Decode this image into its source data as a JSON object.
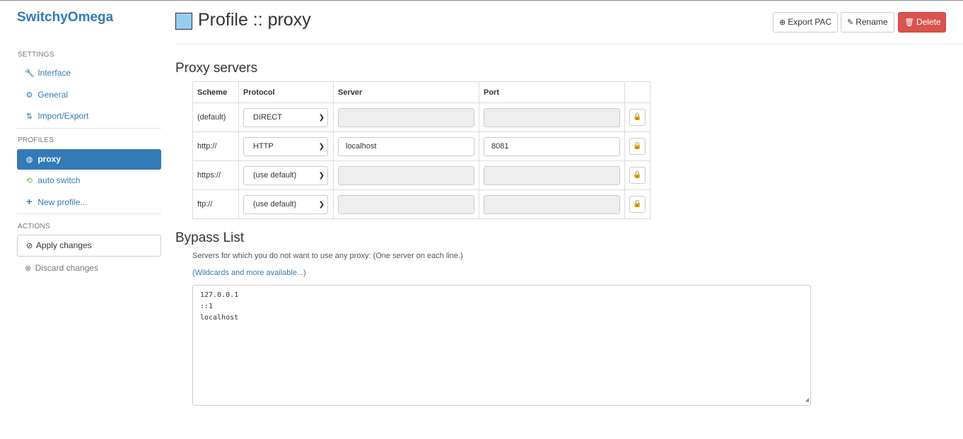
{
  "app": {
    "brand": "SwitchyOmega"
  },
  "sidebar": {
    "settings_title": "SETTINGS",
    "settings": [
      {
        "icon": "wrench-icon",
        "glyph": "🔧",
        "label": "Interface"
      },
      {
        "icon": "gear-icon",
        "glyph": "⚙",
        "label": "General"
      },
      {
        "icon": "import-export-icon",
        "glyph": "⇅",
        "label": "Import/Export"
      }
    ],
    "profiles_title": "PROFILES",
    "profiles": [
      {
        "icon": "globe-icon",
        "glyph": "◍",
        "label": "proxy",
        "active": true
      },
      {
        "icon": "retweet-icon",
        "glyph": "⟲",
        "label": "auto switch"
      },
      {
        "icon": "plus-icon",
        "glyph": "+",
        "label": "New profile..."
      }
    ],
    "actions_title": "ACTIONS",
    "apply_label": "Apply changes",
    "discard_label": "Discard changes"
  },
  "header": {
    "title": "Profile :: proxy",
    "profile_color": "#99ccee",
    "export_label": "Export PAC",
    "rename_label": "Rename",
    "delete_label": "Delete"
  },
  "proxy_servers": {
    "heading": "Proxy servers",
    "columns": [
      "Scheme",
      "Protocol",
      "Server",
      "Port"
    ],
    "rows": [
      {
        "scheme": "(default)",
        "protocol": "DIRECT",
        "server": "",
        "port": "",
        "disabled": true
      },
      {
        "scheme": "http://",
        "protocol": "HTTP",
        "server": "localhost",
        "port": "8081",
        "disabled": false
      },
      {
        "scheme": "https://",
        "protocol": "(use default)",
        "server": "",
        "port": "",
        "disabled": true
      },
      {
        "scheme": "ftp://",
        "protocol": "(use default)",
        "server": "",
        "port": "",
        "disabled": true
      }
    ]
  },
  "bypass": {
    "heading": "Bypass List",
    "help_text": "Servers for which you do not want to use any proxy: (One server on each line.)",
    "help_link": "(Wildcards and more available...)",
    "lines": [
      "127.0.0.1",
      "::1",
      "localhost"
    ]
  },
  "colors": {
    "primary": "#337ab7",
    "danger": "#d9534f",
    "success": "#5cb85c"
  }
}
